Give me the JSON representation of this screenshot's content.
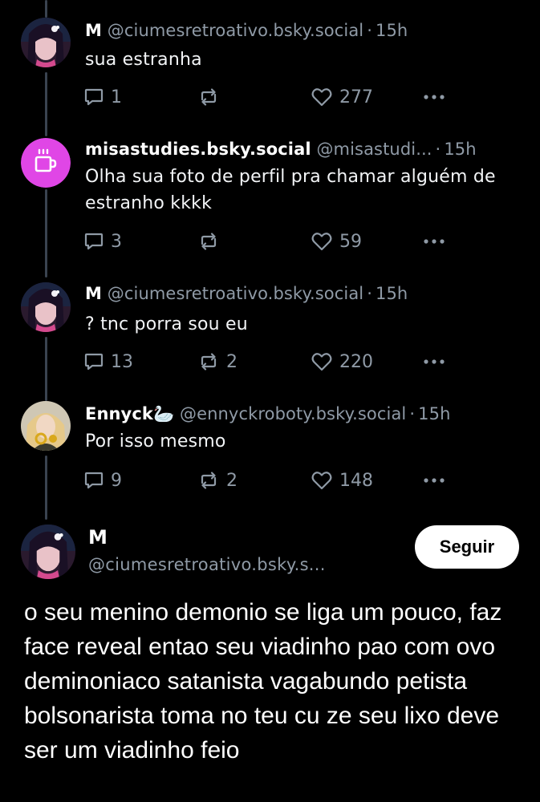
{
  "thread": [
    {
      "name": "M",
      "handle": "@ciumesretroativo.bsky.social",
      "time": "15h",
      "text": "sua estranha",
      "replies": "1",
      "reposts": "",
      "likes": "277"
    },
    {
      "name": "misastudies.bsky.social",
      "handle": "@misastudi...",
      "time": "15h",
      "text": "Olha sua foto de perfil pra chamar alguém de estranho kkkk",
      "replies": "3",
      "reposts": "",
      "likes": "59"
    },
    {
      "name": "M",
      "handle": "@ciumesretroativo.bsky.social",
      "time": "15h",
      "text": "? tnc porra sou eu",
      "replies": "13",
      "reposts": "2",
      "likes": "220"
    },
    {
      "name": "Ennyck🦢",
      "handle": "@ennyckroboty.bsky.social",
      "time": "15h",
      "text": "Por isso mesmo",
      "replies": "9",
      "reposts": "2",
      "likes": "148"
    }
  ],
  "main_post": {
    "name": "M",
    "handle": "@ciumesretroativo.bsky.s...",
    "follow_label": "Seguir",
    "text": "o seu menino demonio se liga um pouco, faz face reveal entao seu viadinho pao com ovo deminoniaco satanista vagabundo petista bolsonarista toma no teu cu ze seu lixo deve ser um viadinho feio"
  },
  "colors": {
    "background": "#000000",
    "muted": "#8f9aa6",
    "thread_line": "#3a4350",
    "avatar_pink": "#e046e6"
  },
  "icons": [
    "reply-icon",
    "repost-icon",
    "like-icon",
    "more-icon",
    "coffee-cup-icon"
  ]
}
